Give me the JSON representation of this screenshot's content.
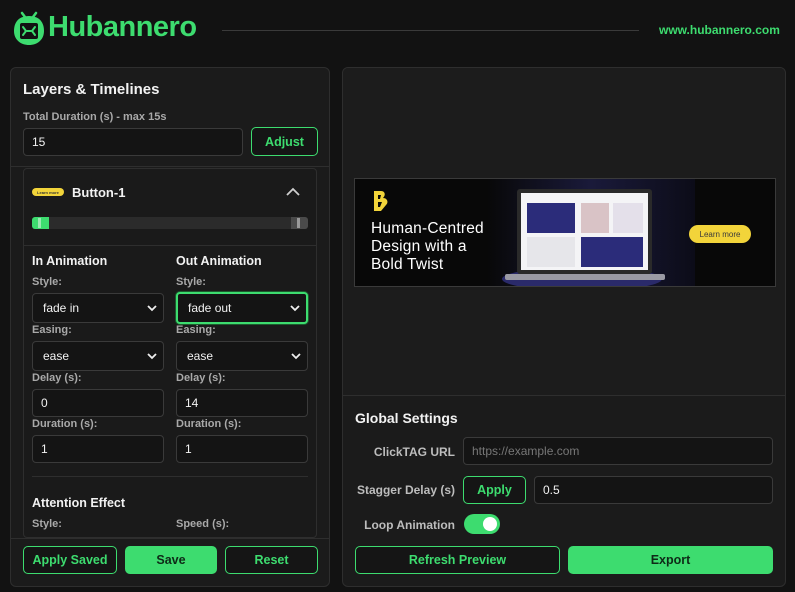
{
  "header": {
    "brand": "Hubannero",
    "url": "www.hubannero.com",
    "accent": "#3ddc6f"
  },
  "layers": {
    "title": "Layers & Timelines",
    "duration_label": "Total Duration (s) - max 15s",
    "duration_value": "15",
    "adjust_label": "Adjust",
    "layer": {
      "badge_text": "Learn more",
      "name": "Button-1",
      "in_start_fraction": 0.0,
      "out_end_fraction": 1.0
    },
    "in_animation": {
      "title": "In Animation",
      "style_label": "Style:",
      "style_value": "fade in",
      "easing_label": "Easing:",
      "easing_value": "ease",
      "delay_label": "Delay (s):",
      "delay_value": "0",
      "duration_label": "Duration (s):",
      "duration_value": "1"
    },
    "out_animation": {
      "title": "Out Animation",
      "style_label": "Style:",
      "style_value": "fade out",
      "easing_label": "Easing:",
      "easing_value": "ease",
      "delay_label": "Delay (s):",
      "delay_value": "14",
      "duration_label": "Duration (s):",
      "duration_value": "1"
    },
    "attention": {
      "title": "Attention Effect",
      "style_label": "Style:",
      "speed_label": "Speed (s):"
    },
    "footer": {
      "apply_saved": "Apply Saved",
      "save": "Save",
      "reset": "Reset"
    }
  },
  "preview": {
    "banner_lines": [
      "Human-Centred",
      "Design with a",
      "Bold Twist"
    ],
    "banner_cta": "Learn more"
  },
  "global_settings": {
    "title": "Global Settings",
    "clicktag_label": "ClickTAG URL",
    "clicktag_placeholder": "https://example.com",
    "stagger_label": "Stagger Delay (s)",
    "stagger_apply": "Apply",
    "stagger_value": "0.5",
    "loop_label": "Loop Animation",
    "loop_on": true,
    "refresh_label": "Refresh Preview",
    "export_label": "Export"
  }
}
